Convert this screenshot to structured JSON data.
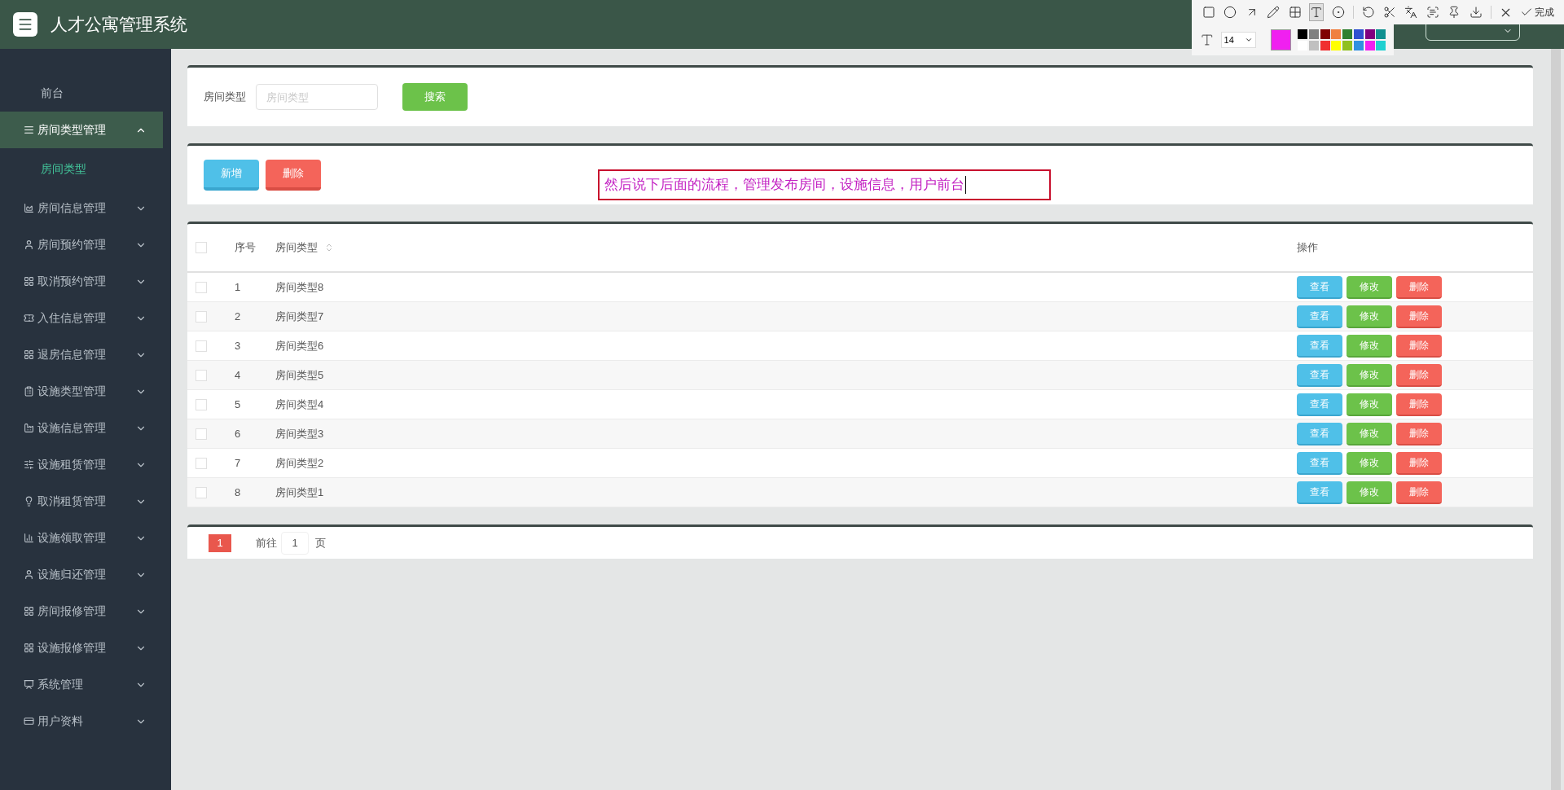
{
  "header": {
    "title": "人才公寓管理系统"
  },
  "sidebar": {
    "items": [
      {
        "label": "前台",
        "kind": "link",
        "selected": false
      },
      {
        "label": "房间类型管理",
        "kind": "group",
        "selected": true,
        "expanded": true,
        "children": [
          {
            "label": "房间类型",
            "selected": true
          }
        ]
      },
      {
        "label": "房间信息管理",
        "kind": "group",
        "selected": false,
        "expanded": false
      },
      {
        "label": "房间预约管理",
        "kind": "group",
        "selected": false,
        "expanded": false
      },
      {
        "label": "取消预约管理",
        "kind": "group",
        "selected": false,
        "expanded": false
      },
      {
        "label": "入住信息管理",
        "kind": "group",
        "selected": false,
        "expanded": false
      },
      {
        "label": "退房信息管理",
        "kind": "group",
        "selected": false,
        "expanded": false
      },
      {
        "label": "设施类型管理",
        "kind": "group",
        "selected": false,
        "expanded": false
      },
      {
        "label": "设施信息管理",
        "kind": "group",
        "selected": false,
        "expanded": false
      },
      {
        "label": "设施租赁管理",
        "kind": "group",
        "selected": false,
        "expanded": false
      },
      {
        "label": "取消租赁管理",
        "kind": "group",
        "selected": false,
        "expanded": false
      },
      {
        "label": "设施领取管理",
        "kind": "group",
        "selected": false,
        "expanded": false
      },
      {
        "label": "设施归还管理",
        "kind": "group",
        "selected": false,
        "expanded": false
      },
      {
        "label": "房间报修管理",
        "kind": "group",
        "selected": false,
        "expanded": false
      },
      {
        "label": "设施报修管理",
        "kind": "group",
        "selected": false,
        "expanded": false
      },
      {
        "label": "系统管理",
        "kind": "group",
        "selected": false,
        "expanded": false
      },
      {
        "label": "用户资料",
        "kind": "group",
        "selected": false,
        "expanded": false
      }
    ]
  },
  "search": {
    "label": "房间类型",
    "placeholder": "房间类型",
    "button": "搜索"
  },
  "actions": [
    {
      "label": "新增",
      "kind": "add"
    },
    {
      "label": "删除",
      "kind": "delete"
    }
  ],
  "annotation": {
    "text": "然后说下后面的流程，管理发布房间，设施信息，用户前台"
  },
  "table": {
    "all_checked": false,
    "columns": [
      {
        "label": "序号",
        "sortable": false
      },
      {
        "label": "房间类型",
        "sortable": true
      },
      {
        "label": "操作",
        "sortable": false
      }
    ],
    "rows": [
      {
        "checked": false,
        "index": "1",
        "name": "房间类型8",
        "actions": [
          {
            "label": "查看",
            "kind": "view"
          },
          {
            "label": "修改",
            "kind": "edit"
          },
          {
            "label": "删除",
            "kind": "delete"
          }
        ]
      },
      {
        "checked": false,
        "index": "2",
        "name": "房间类型7",
        "actions": [
          {
            "label": "查看",
            "kind": "view"
          },
          {
            "label": "修改",
            "kind": "edit"
          },
          {
            "label": "删除",
            "kind": "delete"
          }
        ]
      },
      {
        "checked": false,
        "index": "3",
        "name": "房间类型6",
        "actions": [
          {
            "label": "查看",
            "kind": "view"
          },
          {
            "label": "修改",
            "kind": "edit"
          },
          {
            "label": "删除",
            "kind": "delete"
          }
        ]
      },
      {
        "checked": false,
        "index": "4",
        "name": "房间类型5",
        "actions": [
          {
            "label": "查看",
            "kind": "view"
          },
          {
            "label": "修改",
            "kind": "edit"
          },
          {
            "label": "删除",
            "kind": "delete"
          }
        ]
      },
      {
        "checked": false,
        "index": "5",
        "name": "房间类型4",
        "actions": [
          {
            "label": "查看",
            "kind": "view"
          },
          {
            "label": "修改",
            "kind": "edit"
          },
          {
            "label": "删除",
            "kind": "delete"
          }
        ]
      },
      {
        "checked": false,
        "index": "6",
        "name": "房间类型3",
        "actions": [
          {
            "label": "查看",
            "kind": "view"
          },
          {
            "label": "修改",
            "kind": "edit"
          },
          {
            "label": "删除",
            "kind": "delete"
          }
        ]
      },
      {
        "checked": false,
        "index": "7",
        "name": "房间类型2",
        "actions": [
          {
            "label": "查看",
            "kind": "view"
          },
          {
            "label": "修改",
            "kind": "edit"
          },
          {
            "label": "删除",
            "kind": "delete"
          }
        ]
      },
      {
        "checked": false,
        "index": "8",
        "name": "房间类型1",
        "actions": [
          {
            "label": "查看",
            "kind": "view"
          },
          {
            "label": "修改",
            "kind": "edit"
          },
          {
            "label": "删除",
            "kind": "delete"
          }
        ]
      }
    ]
  },
  "pagination": {
    "pages": [
      {
        "label": "1",
        "selected": true
      }
    ],
    "goto_label": "前往",
    "goto_value": "1",
    "page_suffix": "页"
  },
  "screenshot_toolbar": {
    "tools": [
      {
        "selected": false
      },
      {
        "selected": false
      },
      {
        "selected": false
      },
      {
        "selected": false
      },
      {
        "selected": false
      },
      {
        "selected": true
      },
      {
        "selected": false
      }
    ],
    "confirm": "完成",
    "font_size": "14",
    "palette": [
      {
        "color": "#000000"
      },
      {
        "color": "#808080"
      },
      {
        "color": "#800000"
      },
      {
        "color": "#f08040"
      },
      {
        "color": "#308030"
      },
      {
        "color": "#3050d0"
      },
      {
        "color": "#800080"
      },
      {
        "color": "#109090"
      },
      {
        "color": "#ffffff"
      },
      {
        "color": "#c0c0c0"
      },
      {
        "color": "#f03030"
      },
      {
        "color": "#ffff00"
      },
      {
        "color": "#90c020"
      },
      {
        "color": "#3090e0"
      },
      {
        "color": "#f020f0",
        "selected": true
      },
      {
        "color": "#20d0d0"
      }
    ]
  }
}
